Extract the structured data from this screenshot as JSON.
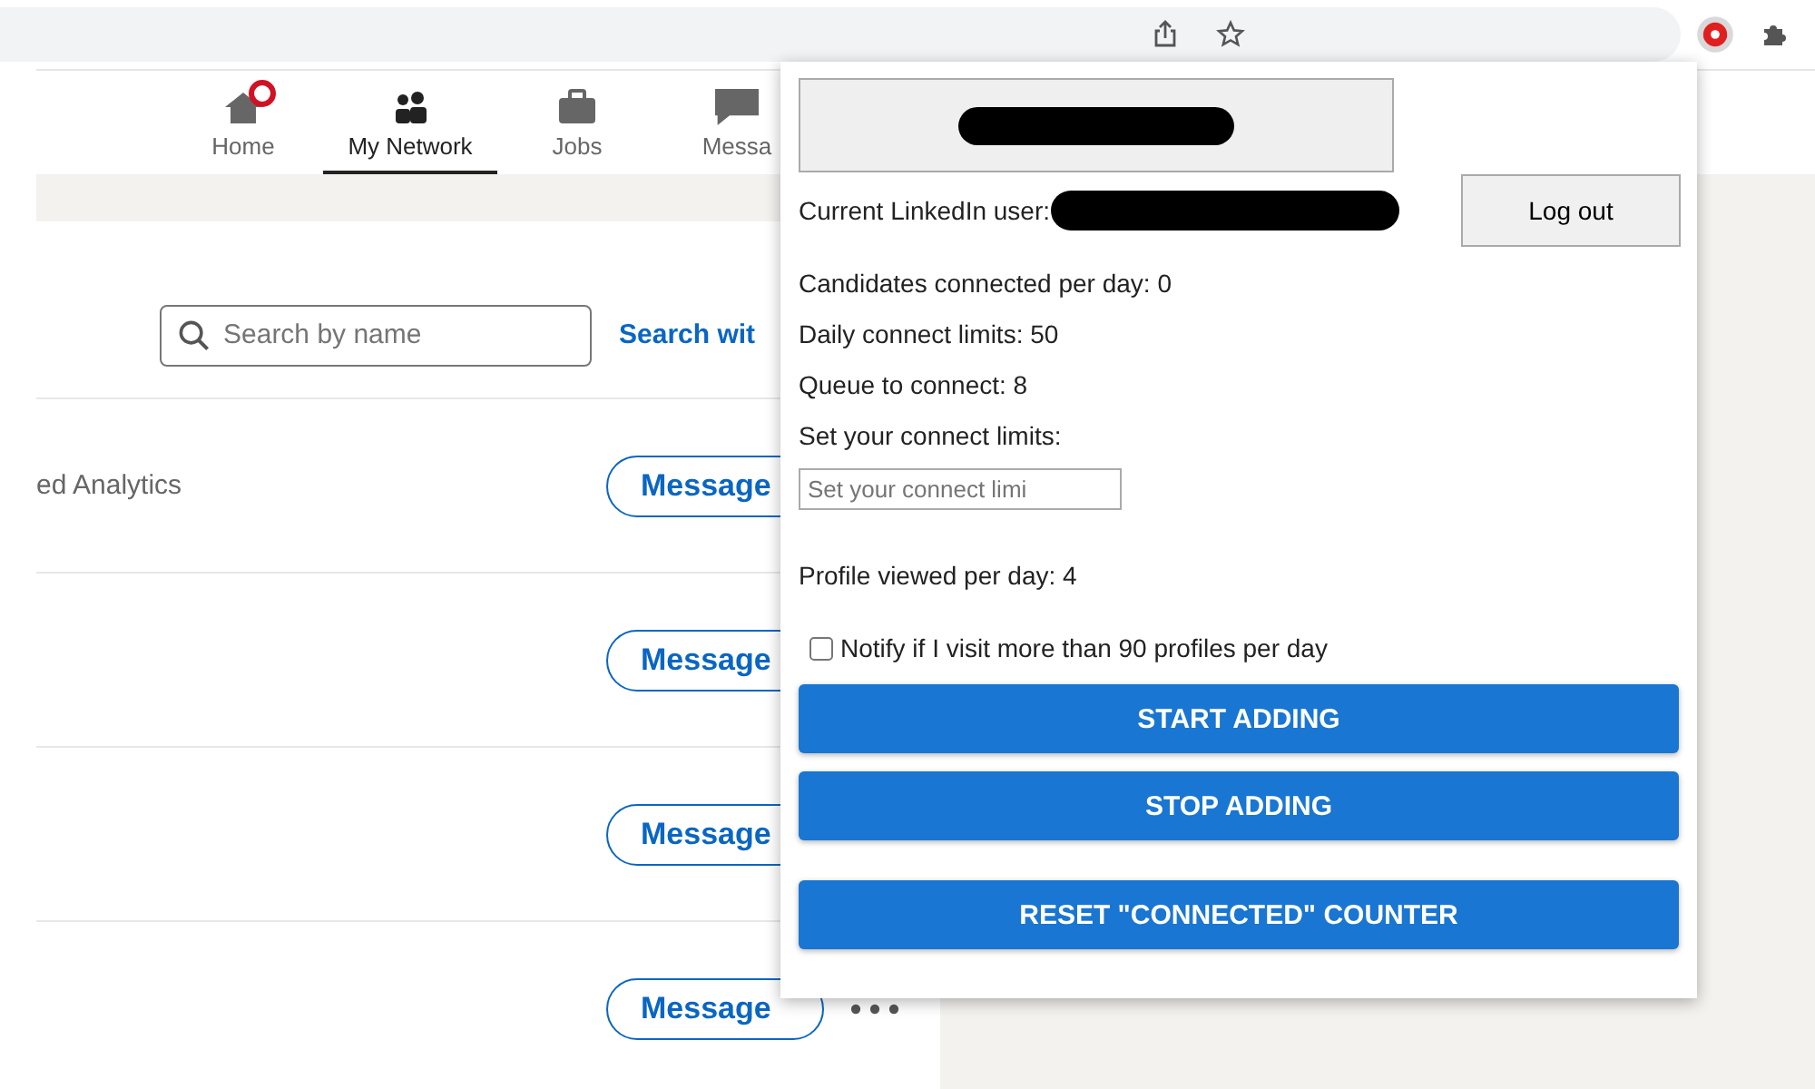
{
  "nav": {
    "items": [
      {
        "label": "Home",
        "selected": false,
        "badge": true
      },
      {
        "label": "My Network",
        "selected": true,
        "badge": false
      },
      {
        "label": "Jobs",
        "selected": false,
        "badge": false
      },
      {
        "label": "Messa",
        "selected": false,
        "badge": false
      }
    ]
  },
  "search": {
    "placeholder": "Search by name",
    "link": "Search wit"
  },
  "connections": [
    {
      "text": "ed Analytics",
      "button": "Message"
    },
    {
      "button": "Message"
    },
    {
      "button": "Message"
    },
    {
      "button": "Message"
    }
  ],
  "popup": {
    "account_redacted": true,
    "user_label": "Current LinkedIn user:",
    "user_redacted": true,
    "logout": "Log out",
    "stats": [
      "Candidates connected per day: 0",
      "Daily connect limits: 50",
      "Queue to connect: 8",
      "Set your connect limits:"
    ],
    "limit_field": {
      "placeholder": "Set your connect limi"
    },
    "profile_viewed": "Profile viewed per day: 4",
    "notify": {
      "label": "Notify if I visit more than 90 profiles per day",
      "checked": false
    },
    "buttons": [
      "START ADDING",
      "STOP ADDING"
    ],
    "reset": "RESET \"CONNECTED\" COUNTER"
  }
}
